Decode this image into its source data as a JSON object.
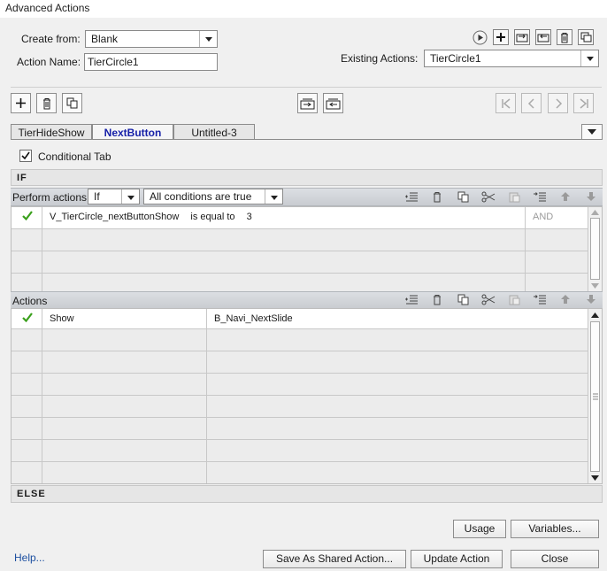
{
  "window": {
    "title": "Advanced Actions"
  },
  "form": {
    "create_from_label": "Create from:",
    "create_from_value": "Blank",
    "action_name_label": "Action Name:",
    "action_name_value": "TierCircle1",
    "existing_actions_label": "Existing Actions:",
    "existing_actions_value": "TierCircle1"
  },
  "tabs": [
    "TierHideShow",
    "NextButton",
    "Untitled-3"
  ],
  "active_tab": "NextButton",
  "conditional_tab": {
    "label": "Conditional Tab",
    "checked": true
  },
  "if_section": {
    "label": "IF",
    "perform_actions_label": "Perform actions:",
    "perform_value": "If",
    "conditions_value": "All conditions are true",
    "rows": [
      {
        "variable": "V_TierCircle_nextButtonShow",
        "operator": "is equal to",
        "value": "3",
        "conjunction": "AND"
      }
    ]
  },
  "actions_section": {
    "label": "Actions",
    "rows": [
      {
        "action": "Show",
        "target": "B_Navi_NextSlide"
      }
    ]
  },
  "else_label": "ELSE",
  "buttons": {
    "usage": "Usage",
    "variables": "Variables...",
    "save_shared": "Save As Shared Action...",
    "update": "Update Action",
    "close": "Close",
    "help": "Help..."
  },
  "colors": {
    "active_tab_text": "#1620a8",
    "check_green": "#3aa01c",
    "link": "#1c4fa0"
  },
  "icons": [
    "play-icon",
    "add-icon",
    "import-icon",
    "export-icon",
    "delete-icon",
    "duplicate-icon",
    "first-icon",
    "prev-icon",
    "next-icon",
    "last-icon",
    "cut-icon",
    "paste-icon",
    "insert-row-icon",
    "move-up-icon",
    "move-down-icon"
  ]
}
